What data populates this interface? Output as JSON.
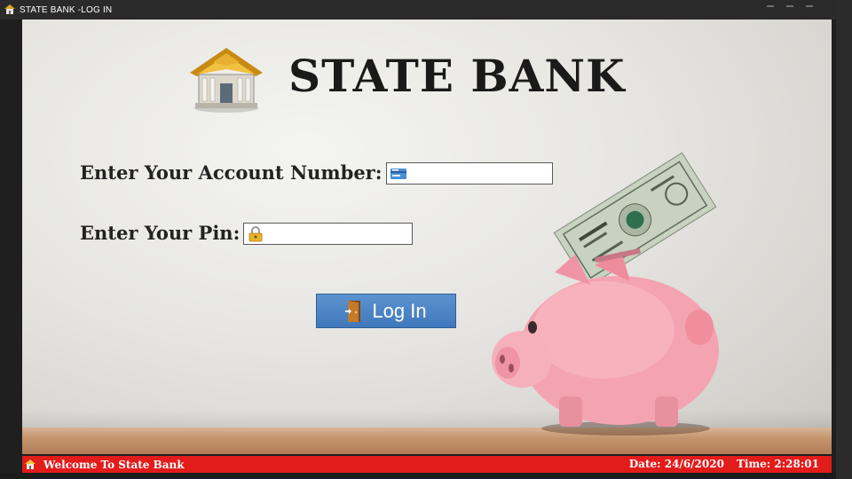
{
  "window": {
    "title": "STATE BANK -LOG IN"
  },
  "header": {
    "bank_name": "STATE BANK",
    "logo_icon": "bank-house-icon"
  },
  "form": {
    "account_label": "Enter Your Account Number:",
    "account_value": "",
    "account_icon": "bank-card-icon",
    "pin_label": "Enter Your Pin:",
    "pin_value": "",
    "pin_icon": "padlock-icon",
    "login_label": "Log In",
    "login_icon": "door-icon"
  },
  "status": {
    "welcome": "Welcome To State Bank",
    "date": "Date: 24/6/2020",
    "time": "Time: 2:28:01"
  },
  "colors": {
    "status_bar": "#e21b1b",
    "button": "#4a82c3",
    "title_bar": "#2a2a2a"
  }
}
